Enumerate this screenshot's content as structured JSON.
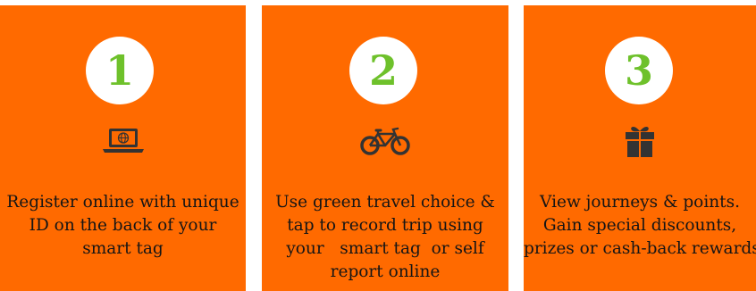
{
  "steps": [
    {
      "number": "1",
      "icon": "laptop-globe-icon",
      "lines": [
        "Register online with unique",
        "ID on the back of your",
        "smart tag"
      ]
    },
    {
      "number": "2",
      "icon": "bicycle-icon",
      "lines": [
        "Use green travel choice &",
        "tap to record trip using",
        "your   smart tag  or self",
        "report online"
      ]
    },
    {
      "number": "3",
      "icon": "gift-icon",
      "lines": [
        "View journeys & points.",
        "Gain special discounts,",
        "prizes or cash-back rewards"
      ]
    }
  ],
  "colors": {
    "panel": "#ff6a00",
    "number": "#6ec12b",
    "icon": "#333333",
    "text": "#151515"
  }
}
